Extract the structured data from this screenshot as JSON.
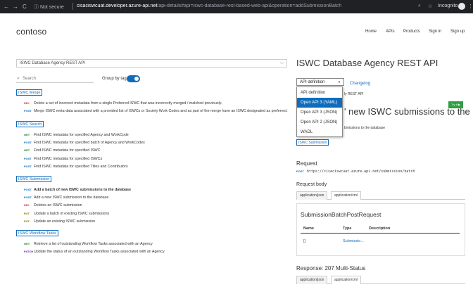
{
  "browser": {
    "nav_back": "←",
    "nav_forward": "→",
    "nav_reload": "C",
    "security_label": "ⓘ Not secure",
    "url_host": "cisaciswcuat.developer.azure-api.net",
    "url_path": "/api-details#api=iswc-database-rest-based-web-api&operation=addSubmissionBatch",
    "zoom_icon": "⌕",
    "star_icon": "☆",
    "profile_label": "Incognito",
    "menu_icon": "⋮"
  },
  "site": {
    "logo": "contoso",
    "nav": [
      "Home",
      "APIs",
      "Products",
      "Sign in",
      "Sign up"
    ]
  },
  "left": {
    "api_select": "ISWC Database Agency REST API",
    "search_placeholder": "Search",
    "group_by_label": "Group by tag",
    "group_by_on": true,
    "groups": [
      {
        "tag": "ISWC Merge",
        "ops": [
          {
            "method": "DEL",
            "color": "#d13438",
            "title": "Delete a set of incorrect metadata from a single Preferred ISWC that was incorrectly merged / matched previously."
          },
          {
            "method": "POST",
            "color": "#0f6cbd",
            "title": "Merge ISWC meta-data associated with a provided list of ISWCs or Society Work Codes and as part of the merge have an ISWC designated as preferred."
          }
        ]
      },
      {
        "tag": "ISWC Search",
        "ops": [
          {
            "method": "GET",
            "color": "#107c10",
            "title": "Find ISWC metadata for specified Agency and WorkCode"
          },
          {
            "method": "POST",
            "color": "#0f6cbd",
            "title": "Find ISWC metadata for specified batch of Agency and WorkCodes"
          },
          {
            "method": "GET",
            "color": "#107c10",
            "title": "Find ISWC metadata for specified ISWC"
          },
          {
            "method": "POST",
            "color": "#0f6cbd",
            "title": "Find ISWC metadata for specified ISWCs"
          },
          {
            "method": "POST",
            "color": "#0f6cbd",
            "title": "Find ISWC metadata for specified Titles and Contributors"
          }
        ]
      },
      {
        "tag": "ISWC Submission",
        "ops": [
          {
            "method": "POST",
            "color": "#0f6cbd",
            "title": "Add a batch of new ISWC submissions to the database",
            "active": true
          },
          {
            "method": "POST",
            "color": "#0f6cbd",
            "title": "Add a new ISWC submission to the database"
          },
          {
            "method": "DEL",
            "color": "#d13438",
            "title": "Deletes an ISWC submission"
          },
          {
            "method": "PUT",
            "color": "#8a6d00",
            "title": "Update a batch of existing ISWC submissions"
          },
          {
            "method": "PUT",
            "color": "#8a6d00",
            "title": "Update an existing ISWC submission"
          }
        ]
      },
      {
        "tag": "ISWC Workflow Tasks",
        "ops": [
          {
            "method": "GET",
            "color": "#107c10",
            "title": "Retrieve a list of outstanding Workflow Tasks associated with an Agency"
          },
          {
            "method": "PATCH",
            "color": "#5c2d91",
            "title": "Update the status of an outstanding Workflow Tasks associated with an Agency"
          }
        ]
      }
    ]
  },
  "right": {
    "title": "ISWC Database Agency REST API",
    "definition_select": "API definition",
    "changelog": "Changelog",
    "dropdown_options": [
      "API definition",
      "Open API 3 (YAML)",
      "Open API 3 (JSON)",
      "Open API 2 (JSON)",
      "WADL"
    ],
    "dropdown_selected": 1,
    "hidden_line1": "ly REST API",
    "hidden_heading": "' new ISWC submissions to the",
    "hidden_line3": "bmissions to the database",
    "try_it": "Try it ▶",
    "tag": "ISWC Submission",
    "request_heading": "Request",
    "request_method": "POST",
    "request_url": "https://cisaciswcuat.azure-api.net/submission/batch",
    "request_body_heading": "Request body",
    "body_tabs": [
      "application/json",
      "application/xml"
    ],
    "schema_title": "SubmissionBatchPostRequest",
    "schema_headers": [
      "Name",
      "Type",
      "Description"
    ],
    "schema_row": {
      "name": "[]",
      "type": "Submissio..."
    },
    "response_heading": "Response: 207 Multi-Status",
    "response_tabs": [
      "application/json",
      "application/xml"
    ]
  }
}
